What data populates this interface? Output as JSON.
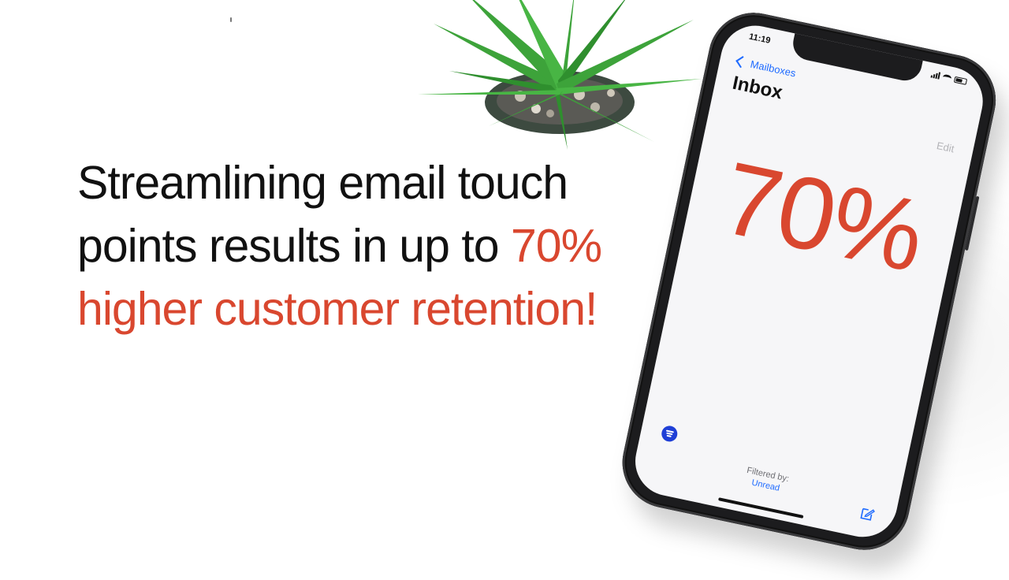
{
  "headline": {
    "line1": "Streamlining email touch",
    "line2_start": "points results in up to ",
    "line2_accent": "70%",
    "line3": "higher customer retention!"
  },
  "phone": {
    "time": "11:19",
    "back_label": "Mailboxes",
    "title": "Inbox",
    "edit_label": "Edit",
    "stat": "70%",
    "filtered_by_label": "Filtered by:",
    "filter_value": "Unread"
  },
  "icons": {
    "back": "chevron-left-icon",
    "filter": "filter-icon",
    "compose": "compose-icon",
    "plant": "potted-plant"
  },
  "colors": {
    "accent": "#d9472f",
    "link_blue": "#1f6bff",
    "phone_frame": "#1c1c1e"
  }
}
